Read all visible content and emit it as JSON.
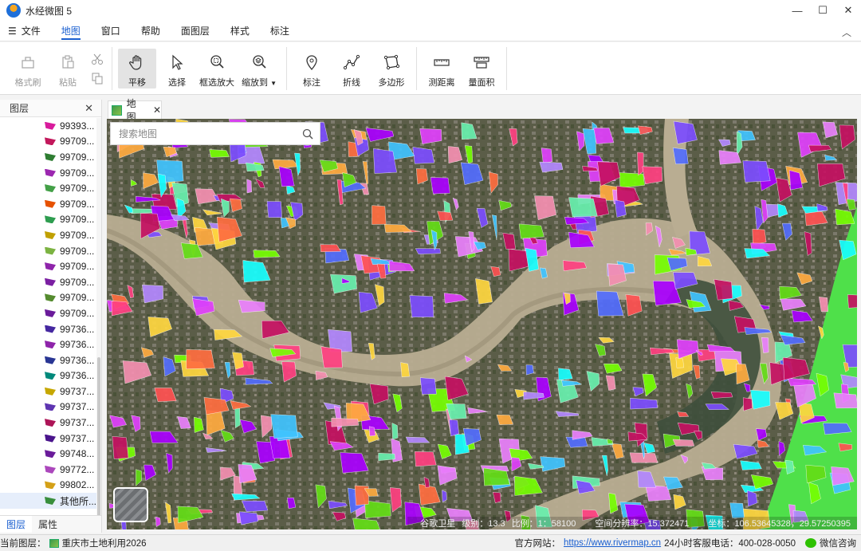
{
  "app": {
    "title": "水经微图 5"
  },
  "window_controls": {
    "minimize": "—",
    "maximize": "☐",
    "close": "✕"
  },
  "menu": {
    "items": [
      "文件",
      "地图",
      "窗口",
      "帮助",
      "面图层",
      "样式",
      "标注"
    ],
    "active": "地图"
  },
  "ribbon": {
    "tools": {
      "format_brush": "格式刷",
      "paste": "粘贴",
      "pan": "平移",
      "select": "选择",
      "zoom_box": "框选放大",
      "zoom_to": "缩放到",
      "marker": "标注",
      "polyline": "折线",
      "polygon": "多边形",
      "measure_distance": "测距离",
      "measure_area": "量面积"
    }
  },
  "left_panel": {
    "title": "图层",
    "layers": [
      {
        "name": "99393...",
        "color": "#d81b9c"
      },
      {
        "name": "99709...",
        "color": "#c2185b"
      },
      {
        "name": "99709...",
        "color": "#2e7d32"
      },
      {
        "name": "99709...",
        "color": "#9c27b0"
      },
      {
        "name": "99709...",
        "color": "#43a047"
      },
      {
        "name": "99709...",
        "color": "#e65100"
      },
      {
        "name": "99709...",
        "color": "#2e9d4f"
      },
      {
        "name": "99709...",
        "color": "#c0a000"
      },
      {
        "name": "99709...",
        "color": "#7cb342"
      },
      {
        "name": "99709...",
        "color": "#8e24aa"
      },
      {
        "name": "99709...",
        "color": "#7b1fa2"
      },
      {
        "name": "99709...",
        "color": "#558b2f"
      },
      {
        "name": "99709...",
        "color": "#6a1b9a"
      },
      {
        "name": "99736...",
        "color": "#4527a0"
      },
      {
        "name": "99736...",
        "color": "#8e24aa"
      },
      {
        "name": "99736...",
        "color": "#283593"
      },
      {
        "name": "99736...",
        "color": "#00897b"
      },
      {
        "name": "99737...",
        "color": "#c6a700"
      },
      {
        "name": "99737...",
        "color": "#5e35b1"
      },
      {
        "name": "99737...",
        "color": "#ad1457"
      },
      {
        "name": "99737...",
        "color": "#4a148c"
      },
      {
        "name": "99748...",
        "color": "#6a1b9a"
      },
      {
        "name": "99772...",
        "color": "#ab47bc"
      },
      {
        "name": "99802...",
        "color": "#d4a017"
      },
      {
        "name": "其他所...",
        "color": "#388e3c"
      }
    ],
    "tabs": [
      "图层",
      "属性"
    ],
    "active_tab": "图层"
  },
  "doc_tab": {
    "label": "地图"
  },
  "map": {
    "search_placeholder": "搜索地图",
    "status": {
      "source": "谷歌卫星",
      "level": "级别：13.3",
      "scale": "比例：1：58100",
      "resolution": "空间分辨率：15.372471",
      "coords": "坐标：106.53645328，29.57250395"
    }
  },
  "statusbar": {
    "current_layer_label": "当前图层：",
    "current_layer": "重庆市土地利用2026",
    "website_label": "官方网站：",
    "website": "https://www.rivermap.cn",
    "hotline": "24小时客服电话：400-028-0050",
    "wechat": "微信咨询"
  }
}
